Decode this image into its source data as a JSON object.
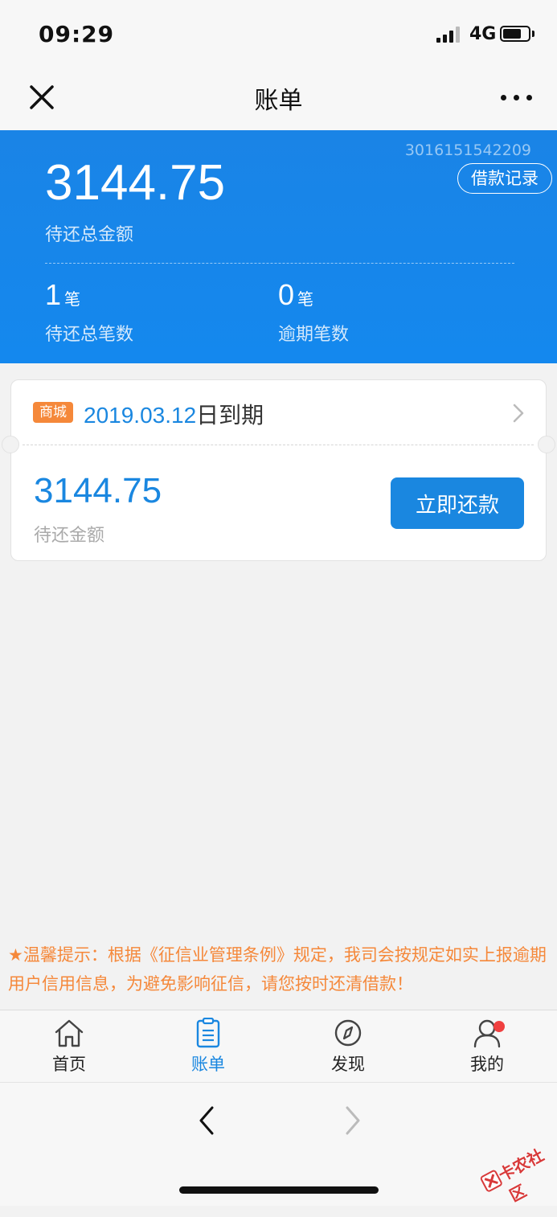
{
  "status_bar": {
    "time": "09:29",
    "network": "4G"
  },
  "nav": {
    "title": "账单"
  },
  "summary": {
    "account_no": "3016151542209",
    "loan_record_label": "借款记录",
    "total_amount": "3144.75",
    "total_amount_label": "待还总金额",
    "pending_count": "1",
    "pending_unit": "笔",
    "pending_label": "待还总笔数",
    "overdue_count": "0",
    "overdue_unit": "笔",
    "overdue_label": "逾期笔数"
  },
  "bill": {
    "badge": "商城",
    "due_date": "2019.03.12",
    "due_suffix": "日到期",
    "amount": "3144.75",
    "amount_label": "待还金额",
    "repay_label": "立即还款"
  },
  "notice": {
    "text": "★温馨提示：根据《征信业管理条例》规定，我司会按规定如实上报逾期用户信用信息，为避免影响征信，请您按时还清借款！"
  },
  "tabs": [
    {
      "label": "首页",
      "icon": "home-icon",
      "active": false
    },
    {
      "label": "账单",
      "icon": "bill-icon",
      "active": true
    },
    {
      "label": "发现",
      "icon": "compass-icon",
      "active": false
    },
    {
      "label": "我的",
      "icon": "user-icon",
      "active": false
    }
  ],
  "watermark": {
    "text": "卡农社区"
  },
  "colors": {
    "primary": "#1a87e0",
    "accent": "#f5883a",
    "badge_dot": "#f04040"
  }
}
